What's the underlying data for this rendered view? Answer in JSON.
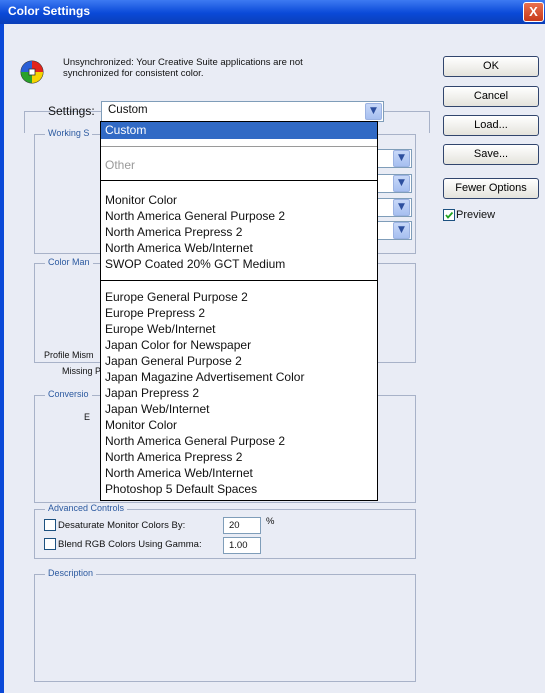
{
  "window": {
    "title": "Color Settings",
    "close_symbol": "X"
  },
  "warning": {
    "icon": "color-wheel-icon",
    "text_line1": "Unsynchronized: Your Creative Suite applications are not",
    "text_line2": "synchronized for consistent color."
  },
  "buttons": {
    "ok": "OK",
    "cancel": "Cancel",
    "load": "Load...",
    "save": "Save...",
    "fewer_options": "Fewer Options"
  },
  "preview": {
    "label": "Preview",
    "checked": true
  },
  "settings": {
    "label": "Settings:",
    "value": "Custom",
    "options": {
      "selected": "Custom",
      "other": "Other",
      "group1": [
        "Monitor Color",
        "North America General Purpose 2",
        "North America Prepress 2",
        "North America Web/Internet",
        "SWOP Coated 20% GCT Medium"
      ],
      "group2": [
        "Europe General Purpose 2",
        "Europe Prepress 2",
        "Europe Web/Internet",
        "Japan Color for Newspaper",
        "Japan General Purpose 2",
        "Japan Magazine Advertisement Color",
        "Japan Prepress 2",
        "Japan Web/Internet",
        "Monitor Color",
        "North America General Purpose 2",
        "North America Prepress 2",
        "North America Web/Internet",
        "Photoshop 5 Default Spaces"
      ]
    }
  },
  "groups": {
    "working_spaces": "Working S",
    "color_management": "Color Man",
    "profile_mismatches": "Profile Mism",
    "missing_profiles": "Missing P",
    "conversion": "Conversio",
    "conversion_partial": "E",
    "advanced_controls": "Advanced Controls",
    "description": "Description"
  },
  "advanced": {
    "desaturate_label": "Desaturate Monitor Colors By:",
    "desaturate_value": "20",
    "desaturate_unit": "%",
    "blend_label": "Blend RGB Colors Using Gamma:",
    "blend_value": "1.00"
  }
}
